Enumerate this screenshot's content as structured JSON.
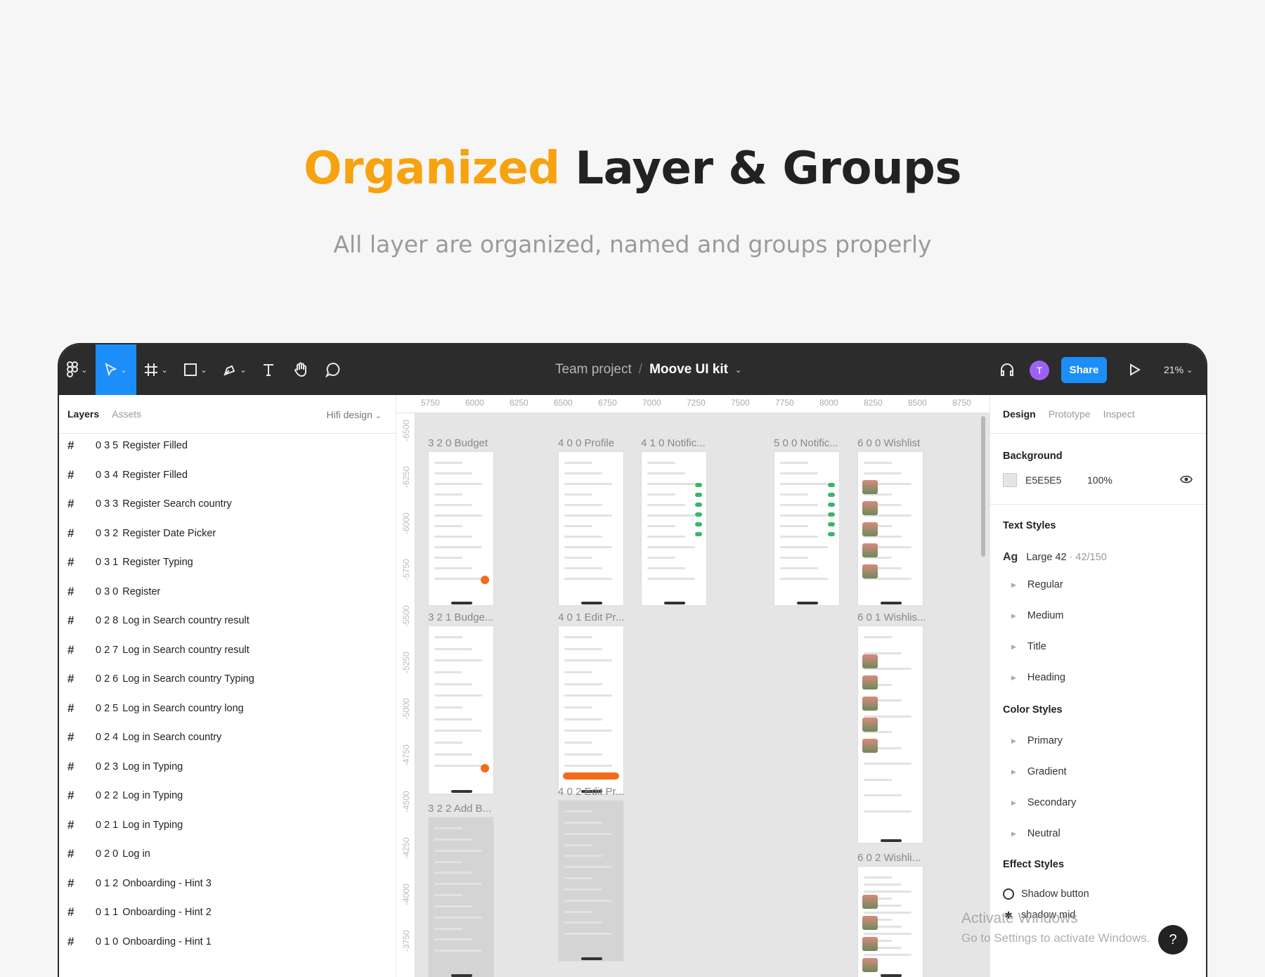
{
  "hero": {
    "title_accent": "Organized",
    "title_rest": "Layer & Groups",
    "subtitle": "All layer are organized, named and groups properly",
    "accent_color": "#f6a30f"
  },
  "toolbar": {
    "icons": [
      "figma-menu-icon",
      "move-tool-icon",
      "frame-tool-icon",
      "shape-tool-icon",
      "pen-tool-icon",
      "text-tool-icon",
      "hand-tool-icon",
      "comment-tool-icon"
    ],
    "team": "Team project",
    "separator": "/",
    "file": "Moove UI kit",
    "avatar_initial": "T",
    "share_label": "Share",
    "zoom": "21%",
    "caret": "⌄"
  },
  "left_panel": {
    "tab_layers": "Layers",
    "tab_assets": "Assets",
    "page": "Hifi design",
    "layers": [
      {
        "num": "0 3 5",
        "name": "Register Filled"
      },
      {
        "num": "0 3 4",
        "name": "Register Filled"
      },
      {
        "num": "0 3 3",
        "name": "Register Search country"
      },
      {
        "num": "0 3 2",
        "name": "Register Date Picker"
      },
      {
        "num": "0 3 1",
        "name": "Register Typing"
      },
      {
        "num": "0 3 0",
        "name": "Register"
      },
      {
        "num": "0 2 8",
        "name": "Log in Search country result"
      },
      {
        "num": "0 2 7",
        "name": "Log in Search country result"
      },
      {
        "num": "0 2 6",
        "name": "Log in Search country Typing"
      },
      {
        "num": "0 2 5",
        "name": "Log in Search country long"
      },
      {
        "num": "0 2 4",
        "name": "Log in Search country"
      },
      {
        "num": "0 2 3",
        "name": "Log in Typing"
      },
      {
        "num": "0 2 2",
        "name": "Log in Typing"
      },
      {
        "num": "0 2 1",
        "name": "Log in Typing"
      },
      {
        "num": "0 2 0",
        "name": "Log in"
      },
      {
        "num": "0 1 2",
        "name": "Onboarding - Hint 3"
      },
      {
        "num": "0 1 1",
        "name": "Onboarding - Hint 2"
      },
      {
        "num": "0 1 0",
        "name": "Onboarding - Hint 1"
      }
    ]
  },
  "canvas": {
    "ruler_x": [
      "5750",
      "6000",
      "6250",
      "6500",
      "6750",
      "7000",
      "7250",
      "7500",
      "7750",
      "8000",
      "8250",
      "8500",
      "8750"
    ],
    "ruler_y": [
      "-6500",
      "-6250",
      "-6000",
      "-5750",
      "-5500",
      "-5250",
      "-5000",
      "-4750",
      "-4500",
      "-4250",
      "-4000",
      "-3750"
    ],
    "frames": [
      {
        "label": "3 2 0 Budget"
      },
      {
        "label": "4 0 0  Profile"
      },
      {
        "label": "4 1 0 Notific..."
      },
      {
        "label": "5 0 0 Notific..."
      },
      {
        "label": "6 0 0 Wishlist"
      },
      {
        "label": "3 2 1 Budge..."
      },
      {
        "label": "4 0 1 Edit Pr..."
      },
      {
        "label": "6 0 1 Wishlis..."
      },
      {
        "label": "3 2 2 Add B..."
      },
      {
        "label": "4 0 2 Edit Pr..."
      },
      {
        "label": "6 0 2 Wishli..."
      }
    ]
  },
  "right_panel": {
    "tab_design": "Design",
    "tab_prototype": "Prototype",
    "tab_inspect": "Inspect",
    "background_title": "Background",
    "background_hex": "E5E5E5",
    "background_opacity": "100%",
    "text_styles_title": "Text Styles",
    "text_style_sample": "Ag",
    "text_style_name": "Large 42",
    "text_style_meta": "· 42/150",
    "text_styles": [
      "Regular",
      "Medium",
      "Title",
      "Heading"
    ],
    "color_styles_title": "Color Styles",
    "color_styles": [
      "Primary",
      "Gradient",
      "Secondary",
      "Neutral"
    ],
    "effect_styles_title": "Effect Styles",
    "effect_first": "Shadow button",
    "effect_second": "shadow mid"
  },
  "watermark": {
    "line1": "Activate Windows",
    "line2": "Go to Settings to activate Windows."
  },
  "help_label": "?"
}
